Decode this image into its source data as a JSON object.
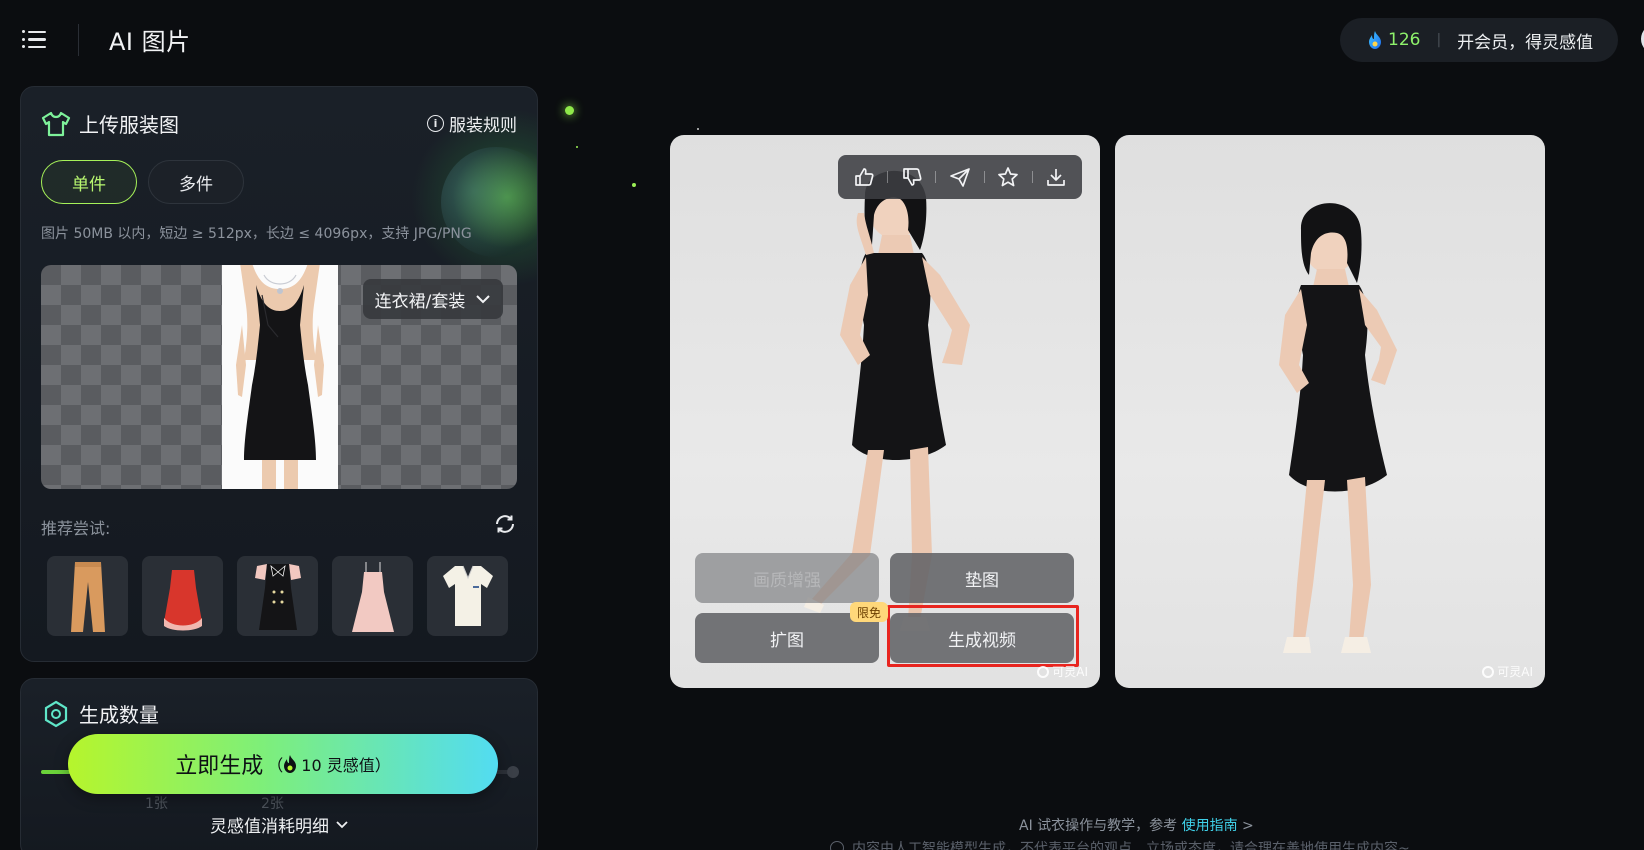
{
  "header": {
    "app_title": "AI 图片",
    "points": "126",
    "vip_text": "开会员，得灵感值",
    "menu_icon": "menu-icon",
    "accent_color": "#8ef26b"
  },
  "upload_panel": {
    "title": "上传服装图",
    "rules_label": "服装规则",
    "modes": [
      "单件",
      "多件"
    ],
    "selected_mode": "单件",
    "hint": "图片 50MB 以内，短边 ≥ 512px，长边 ≤ 4096px，支持 JPG/PNG",
    "category": "连衣裙/套装",
    "recommend_label": "推荐尝试:",
    "recommend_items": [
      "pants",
      "red-dress",
      "black-bow-dress",
      "pink-slip-dress",
      "polo-shirt"
    ]
  },
  "count_panel": {
    "title": "生成数量",
    "tick_left": "1张",
    "tick_right": "2张"
  },
  "generate": {
    "label": "立即生成",
    "open_paren": "（",
    "cost": "10 灵感值",
    "close_paren": "）",
    "gradient": [
      "#b6f52c",
      "#52dcf2"
    ]
  },
  "consume_detail": "灵感值消耗明细",
  "result": {
    "actions": {
      "enhance": "画质增强",
      "mat": "垫图",
      "expand": "扩图",
      "video": "生成视频"
    },
    "free_badge": "限免",
    "watermark": "可灵AI",
    "toolbar_icons": [
      "thumbs-up-icon",
      "thumbs-down-icon",
      "share-icon",
      "star-icon",
      "download-icon"
    ],
    "highlight_color": "#e8251f"
  },
  "footer": {
    "tutorial_prefix": "AI 试衣操作与教学，参考 ",
    "tutorial_link": "使用指南",
    "tutorial_suffix": " >",
    "disclaimer": "内容由人工智能模型生成，不代表平台的观点、立场或态度，请合理在善地使用生成内容~"
  }
}
